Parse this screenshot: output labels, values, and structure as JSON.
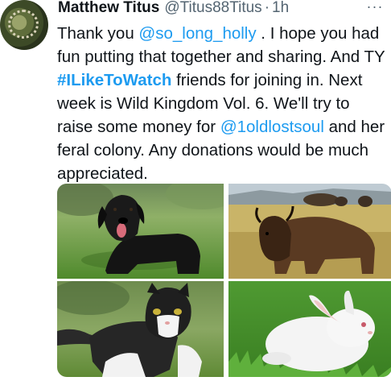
{
  "tweet": {
    "author_name": "Matthew Titus",
    "handle": "@Titus88Titus",
    "separator": "·",
    "time": "1h",
    "more_glyph": "···",
    "text_parts": {
      "p1": "Thank you ",
      "mention1": "@so_long_holly",
      "p2": " . I hope you had fun putting that together and sharing. And TY ",
      "hashtag": "#ILikeToWatch",
      "p3": " friends for joining in. Next week is Wild Kingdom Vol. 6. We'll try to raise some money for ",
      "mention2": "@1oldlostsoul",
      "p4": " and her feral colony. Any donations would be much appreciated."
    }
  },
  "media": {
    "photos": [
      {
        "icon": "black-dog-photo"
      },
      {
        "icon": "bison-photo"
      },
      {
        "icon": "tuxedo-cat-photo"
      },
      {
        "icon": "white-rabbit-photo"
      }
    ]
  },
  "colors": {
    "link": "#1d9bf0",
    "text": "#0f1419",
    "secondary": "#536471"
  }
}
